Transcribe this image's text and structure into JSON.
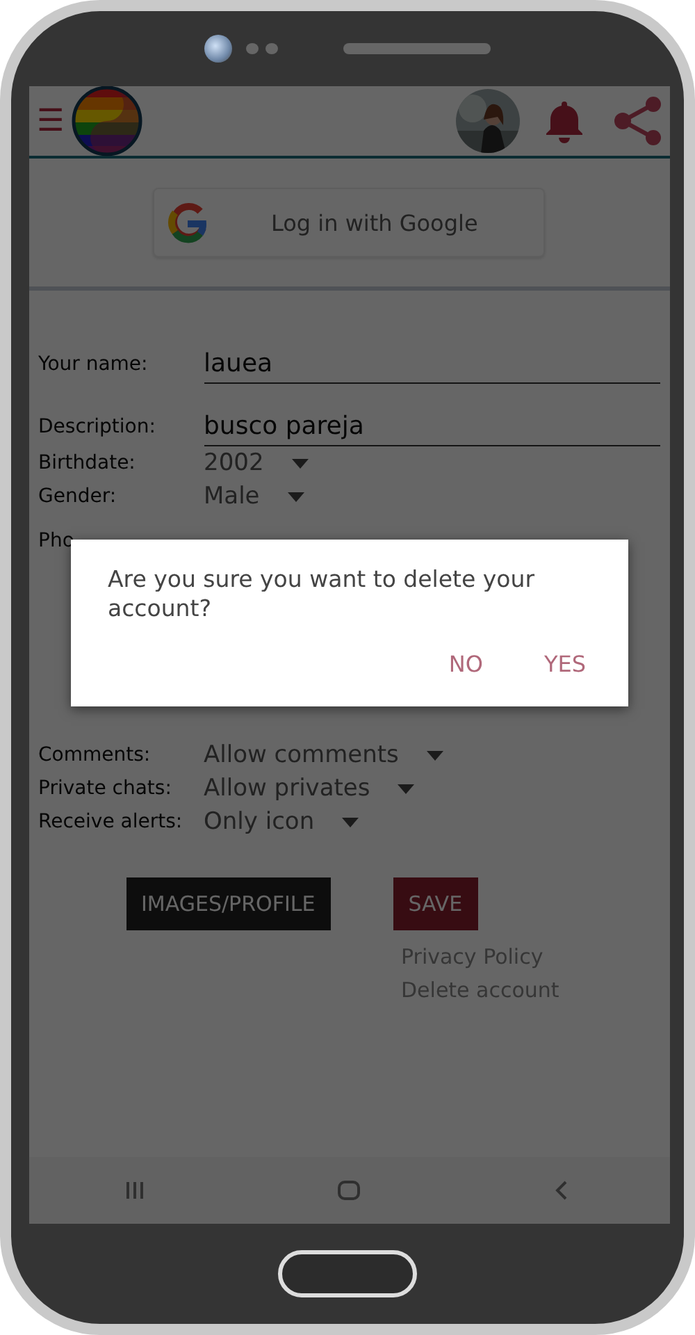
{
  "header": {
    "menu_icon": "☰"
  },
  "google_button": {
    "label": "Log in with Google"
  },
  "form": [
    {
      "kind": "text",
      "label": "Your name:",
      "value": "lauea"
    },
    {
      "kind": "text",
      "label": "Description:",
      "value": "busco pareja"
    },
    {
      "kind": "select",
      "label": "Birthdate:",
      "value": "2002"
    },
    {
      "kind": "select",
      "label": "Gender:",
      "value": "Male"
    },
    {
      "label": "Pho"
    },
    {
      "kind": "select",
      "label": "Comments:",
      "value": "Allow comments"
    },
    {
      "kind": "select",
      "label": "Private chats:",
      "value": "Allow privates"
    },
    {
      "kind": "select",
      "label": "Receive alerts:",
      "value": "Only icon"
    }
  ],
  "buttons": [
    {
      "kind": "dark",
      "label": "IMAGES/PROFILE"
    },
    {
      "kind": "primary",
      "label": "SAVE"
    }
  ],
  "links": [
    "Privacy Policy",
    "Delete account"
  ],
  "dialog": {
    "message": "Are you sure you want to delete your account?",
    "actions": [
      "NO",
      "YES"
    ]
  }
}
